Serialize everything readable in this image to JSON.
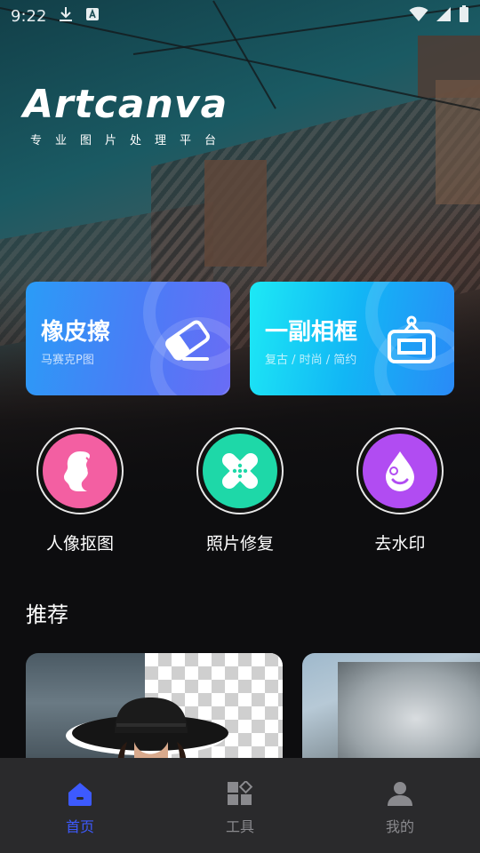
{
  "status_bar": {
    "time": "9:22",
    "icons": [
      "download-icon",
      "a-notification-icon",
      "wifi-icon",
      "signal-icon",
      "battery-icon"
    ]
  },
  "brand": {
    "title": "Artcanva",
    "subtitle": "专业图片处理平台"
  },
  "feature_cards": [
    {
      "title": "橡皮擦",
      "subtitle": "马赛克P图",
      "icon": "eraser-icon"
    },
    {
      "title": "一副相框",
      "subtitle": "复古 / 时尚 / 简约",
      "icon": "frame-icon"
    }
  ],
  "tools": [
    {
      "label": "人像抠图",
      "icon": "portrait-icon",
      "color": "#f35fa2"
    },
    {
      "label": "照片修复",
      "icon": "bandage-icon",
      "color": "#1ed8a8"
    },
    {
      "label": "去水印",
      "icon": "droplet-icon",
      "color": "#b14cf2"
    }
  ],
  "recommend": {
    "title": "推荐"
  },
  "bottom_nav": [
    {
      "label": "首页",
      "icon": "home-icon",
      "active": true
    },
    {
      "label": "工具",
      "icon": "grid-icon",
      "active": false
    },
    {
      "label": "我的",
      "icon": "user-icon",
      "active": false
    }
  ],
  "colors": {
    "nav_active": "#3d5afe",
    "nav_inactive": "#8a8a8e",
    "background": "#0d0d0f"
  }
}
